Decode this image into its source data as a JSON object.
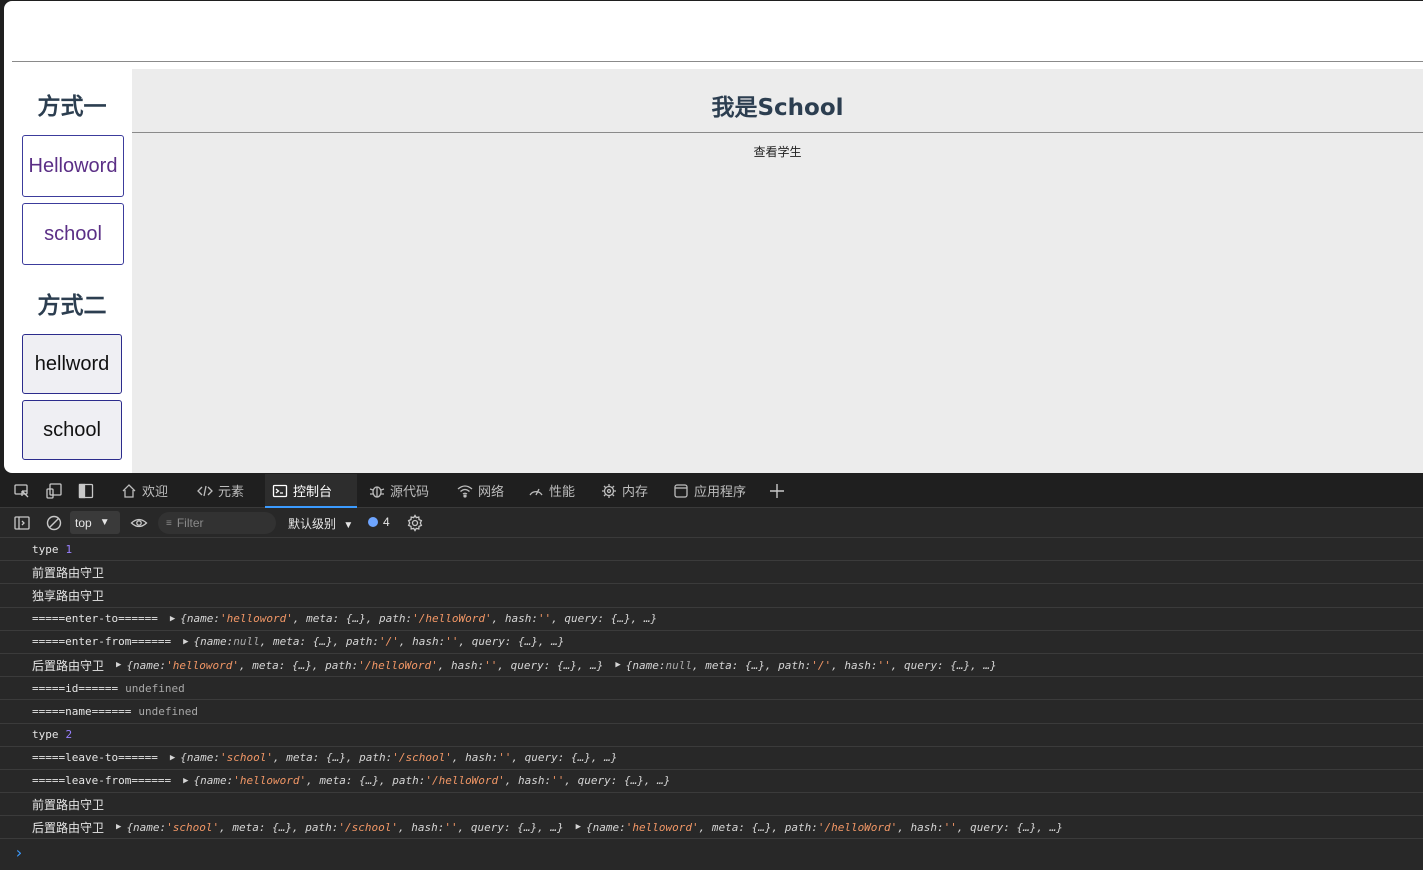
{
  "sidebar": {
    "heading1": "方式一",
    "link_helloword": "Helloword",
    "link_school": "school",
    "heading2": "方式二",
    "btn_hellword": "hellword",
    "btn_school": "school"
  },
  "main": {
    "title": "我是School",
    "view_students": "查看学生"
  },
  "devtools": {
    "tabs": [
      {
        "label": "欢迎",
        "icon": "home-icon"
      },
      {
        "label": "元素",
        "icon": "code-icon"
      },
      {
        "label": "控制台",
        "icon": "console-icon"
      },
      {
        "label": "源代码",
        "icon": "bug-icon"
      },
      {
        "label": "网络",
        "icon": "wifi-icon"
      },
      {
        "label": "性能",
        "icon": "performance-icon"
      },
      {
        "label": "内存",
        "icon": "memory-icon"
      },
      {
        "label": "应用程序",
        "icon": "application-icon"
      }
    ],
    "active_tab": "控制台",
    "context": "top",
    "filter_placeholder": "Filter",
    "level": "默认级别",
    "issues_count": "4"
  },
  "console": {
    "l1": {
      "text": "type",
      "num": "1"
    },
    "l2": "前置路由守卫",
    "l3": "独享路由守卫",
    "l4": {
      "label": "=====enter-to======",
      "pre": "{name: ",
      "s1": "'helloword'",
      "mid1": ", meta: {…}, path: ",
      "s2": "'/helloWord'",
      "mid2": ", hash: ",
      "s3": "''",
      "post": ", query: {…}, …}"
    },
    "l5": {
      "label": "=====enter-from======",
      "pre": "{name: ",
      "nul": "null",
      "mid1": ", meta: {…}, path: ",
      "s2": "'/'",
      "mid2": ", hash: ",
      "s3": "''",
      "post": ", query: {…}, …}"
    },
    "l6": {
      "label": "后置路由守卫",
      "a": {
        "pre": "{name: ",
        "s1": "'helloword'",
        "mid1": ", meta: {…}, path: ",
        "s2": "'/helloWord'",
        "mid2": ", hash: ",
        "s3": "''",
        "post": ", query: {…}, …}"
      },
      "b": {
        "pre": "{name: ",
        "nul": "null",
        "mid1": ", meta: {…}, path: ",
        "s2": "'/'",
        "mid2": ", hash: ",
        "s3": "''",
        "post": ", query: {…}, …}"
      }
    },
    "l7": {
      "text": "=====id======",
      "val": "undefined"
    },
    "l8": {
      "text": "=====name======",
      "val": "undefined"
    },
    "l9": {
      "text": "type",
      "num": "2"
    },
    "l10": {
      "label": "=====leave-to======",
      "pre": "{name: ",
      "s1": "'school'",
      "mid1": ", meta: {…}, path: ",
      "s2": "'/school'",
      "mid2": ", hash: ",
      "s3": "''",
      "post": ", query: {…}, …}"
    },
    "l11": {
      "label": "=====leave-from======",
      "pre": "{name: ",
      "s1": "'helloword'",
      "mid1": ", meta: {…}, path: ",
      "s2": "'/helloWord'",
      "mid2": ", hash: ",
      "s3": "''",
      "post": ", query: {…}, …}"
    },
    "l12": "前置路由守卫",
    "l13": {
      "label": "后置路由守卫",
      "a": {
        "pre": "{name: ",
        "s1": "'school'",
        "mid1": ", meta: {…}, path: ",
        "s2": "'/school'",
        "mid2": ", hash: ",
        "s3": "''",
        "post": ", query: {…}, …}"
      },
      "b": {
        "pre": "{name: ",
        "s1": "'helloword'",
        "mid1": ", meta: {…}, path: ",
        "s2": "'/helloWord'",
        "mid2": ", hash: ",
        "s3": "''",
        "post": ", query: {…}, …}"
      }
    }
  }
}
